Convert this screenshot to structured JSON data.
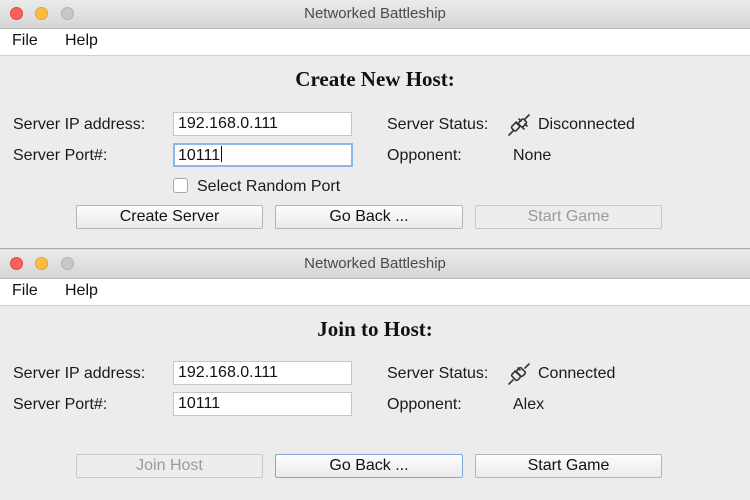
{
  "window_title": "Networked Battleship",
  "menu": {
    "file": "File",
    "help": "Help"
  },
  "host": {
    "heading": "Create New Host:",
    "ip_label": "Server IP address:",
    "ip_value": "192.168.0.111",
    "port_label": "Server Port#:",
    "port_value": "10111",
    "random_port_label": "Select Random Port",
    "status_label": "Server Status:",
    "status_value": "Disconnected",
    "opponent_label": "Opponent:",
    "opponent_value": "None",
    "create_server": "Create Server",
    "go_back": "Go Back ...",
    "start_game": "Start Game"
  },
  "join": {
    "heading": "Join to Host:",
    "ip_label": "Server IP address:",
    "ip_value": "192.168.0.111",
    "port_label": "Server Port#:",
    "port_value": "10111",
    "status_label": "Server Status:",
    "status_value": "Connected",
    "opponent_label": "Opponent:",
    "opponent_value": "Alex",
    "join_host": "Join Host",
    "go_back": "Go Back ...",
    "start_game": "Start Game"
  }
}
